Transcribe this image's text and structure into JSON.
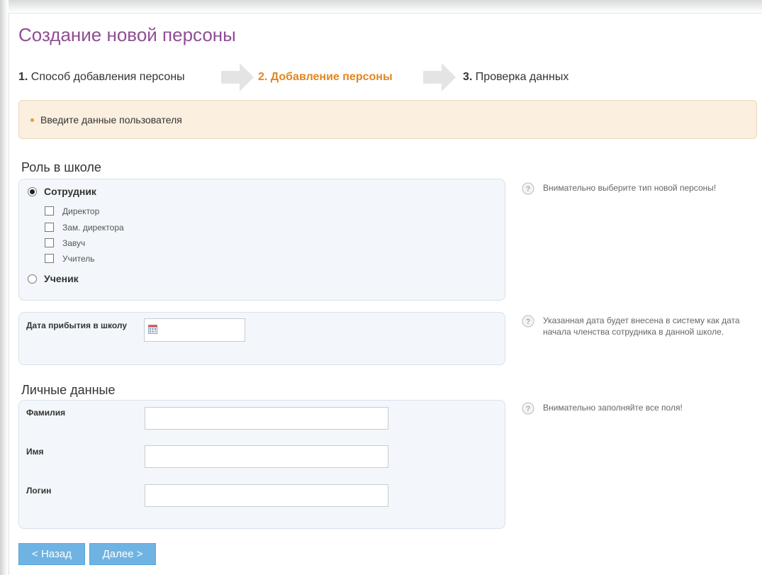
{
  "page": {
    "title": "Создание новой персоны"
  },
  "steps": [
    {
      "num": "1.",
      "label": "Способ добавления персоны",
      "active": false
    },
    {
      "num": "2.",
      "label": "Добавление персоны",
      "active": true
    },
    {
      "num": "3.",
      "label": "Проверка данных",
      "active": false
    }
  ],
  "notice": {
    "text": "Введите данные пользователя"
  },
  "role": {
    "title": "Роль в школе",
    "employee_label": "Сотрудник",
    "employee_selected": true,
    "positions": [
      "Директор",
      "Зам. директора",
      "Завуч",
      "Учитель"
    ],
    "student_label": "Ученик",
    "hint": "Внимательно выберите тип новой персоны!"
  },
  "arrival": {
    "label": "Дата прибытия в школу",
    "value": "",
    "hint": "Указанная дата будет внесена в систему как дата начала членства сотрудника в данной школе."
  },
  "personal": {
    "title": "Личные данные",
    "surname_label": "Фамилия",
    "name_label": "Имя",
    "login_label": "Логин",
    "surname_value": "",
    "name_value": "",
    "login_value": "",
    "hint": "Внимательно заполняйте все поля!"
  },
  "buttons": {
    "back": "< Назад",
    "next": "Далее >"
  },
  "colors": {
    "title": "#8f4e93",
    "active_step": "#e2861f",
    "button": "#6fb3e3",
    "notice_bg": "#fbefdf",
    "panel_bg": "#f3f7fb"
  }
}
